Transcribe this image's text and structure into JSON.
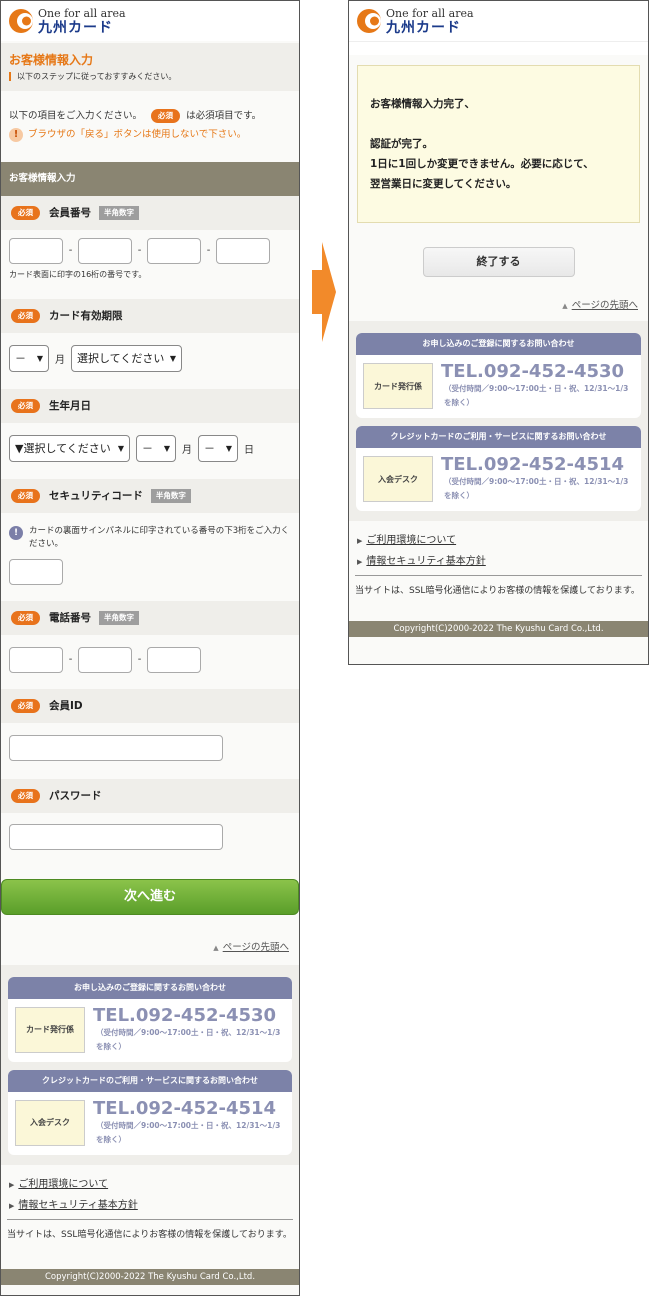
{
  "brand": {
    "tagline": "One for all area",
    "name": "九州カード",
    "color": "#e67817"
  },
  "form": {
    "title": "お客様情報入力",
    "subtitle": "以下のステップに従っておすすみください。",
    "intro_before": "以下の項目をご入力ください。",
    "intro_after": "は必須項目です。",
    "warning": "ブラウザの「戻る」ボタンは使用しないで下さい。",
    "section": "お客様情報入力",
    "required_label": "必須",
    "halfwidth_label": "半角数字",
    "card_number": {
      "label": "会員番号",
      "note": "カード表面に印字の16桁の番号です。"
    },
    "expiry": {
      "label": "カード有効期限",
      "month_value": "－",
      "month_unit": "月",
      "year_value": "選択してください"
    },
    "birthday": {
      "label": "生年月日",
      "year_value": "▼選択してください",
      "month_value": "－",
      "month_unit": "月",
      "day_value": "－",
      "day_unit": "日"
    },
    "security": {
      "label": "セキュリティコード",
      "note": "カードの裏面サインパネルに印字されている番号の下3桁をご入力ください。"
    },
    "phone": {
      "label": "電話番号"
    },
    "member_id": {
      "label": "会員ID"
    },
    "password": {
      "label": "パスワード"
    },
    "next_button": "次へ進む"
  },
  "complete": {
    "line1": "お客様情報入力完了、",
    "line2": "認証が完了。",
    "line3": "1日に1回しか変更できません。必要に応じて、",
    "line4": "翌営業日に変更してください。",
    "end_button": "終了する"
  },
  "common": {
    "to_top": "ページの先頭へ",
    "contacts": [
      {
        "title": "お申し込みのご登録に関するお問い合わせ",
        "desk": "カード発行係",
        "tel": "TEL.092-452-4530",
        "hours": "（受付時間／9:00〜17:00土・日・祝、12/31〜1/3を除く）"
      },
      {
        "title": "クレジットカードのご利用・サービスに関するお問い合わせ",
        "desk": "入会デスク",
        "tel": "TEL.092-452-4514",
        "hours": "（受付時間／9:00〜17:00土・日・祝、12/31〜1/3を除く）"
      }
    ],
    "links": [
      "ご利用環境について",
      "情報セキュリティ基本方針"
    ],
    "ssl": "当サイトは、SSL暗号化通信によりお客様の情報を保護しております。",
    "copyright": "Copyright(C)2000-2022 The Kyushu Card Co.,Ltd."
  },
  "icons": {
    "arrow": "right-arrow-icon",
    "warning": "exclamation-icon",
    "info": "info-icon"
  }
}
